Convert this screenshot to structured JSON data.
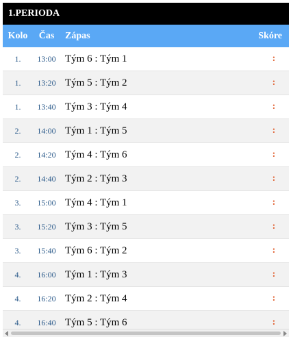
{
  "period_title": "1.PERIODA",
  "columns": {
    "kolo": "Kolo",
    "cas": "Čas",
    "zapas": "Zápas",
    "skore": "Skóre"
  },
  "matches": [
    {
      "kolo": "1.",
      "cas": "13:00",
      "zapas": "Tým 6 : Tým 1",
      "skore": ":"
    },
    {
      "kolo": "1.",
      "cas": "13:20",
      "zapas": "Tým 5 : Tým 2",
      "skore": ":"
    },
    {
      "kolo": "1.",
      "cas": "13:40",
      "zapas": "Tým 3 : Tým 4",
      "skore": ":"
    },
    {
      "kolo": "2.",
      "cas": "14:00",
      "zapas": "Tým 1 : Tým 5",
      "skore": ":"
    },
    {
      "kolo": "2.",
      "cas": "14:20",
      "zapas": "Tým 4 : Tým 6",
      "skore": ":"
    },
    {
      "kolo": "2.",
      "cas": "14:40",
      "zapas": "Tým 2 : Tým 3",
      "skore": ":"
    },
    {
      "kolo": "3.",
      "cas": "15:00",
      "zapas": "Tým 4 : Tým 1",
      "skore": ":"
    },
    {
      "kolo": "3.",
      "cas": "15:20",
      "zapas": "Tým 3 : Tým 5",
      "skore": ":"
    },
    {
      "kolo": "3.",
      "cas": "15:40",
      "zapas": "Tým 6 : Tým 2",
      "skore": ":"
    },
    {
      "kolo": "4.",
      "cas": "16:00",
      "zapas": "Tým 1 : Tým 3",
      "skore": ":"
    },
    {
      "kolo": "4.",
      "cas": "16:20",
      "zapas": "Tým 2 : Tým 4",
      "skore": ":"
    },
    {
      "kolo": "4.",
      "cas": "16:40",
      "zapas": "Tým 5 : Tým 6",
      "skore": ":"
    }
  ],
  "colors": {
    "title_bg": "#000000",
    "header_bg": "#5aa8f5",
    "alt_row_bg": "#f2f2f2",
    "score_color": "#e05a28",
    "meta_text": "#2b5a8a"
  }
}
